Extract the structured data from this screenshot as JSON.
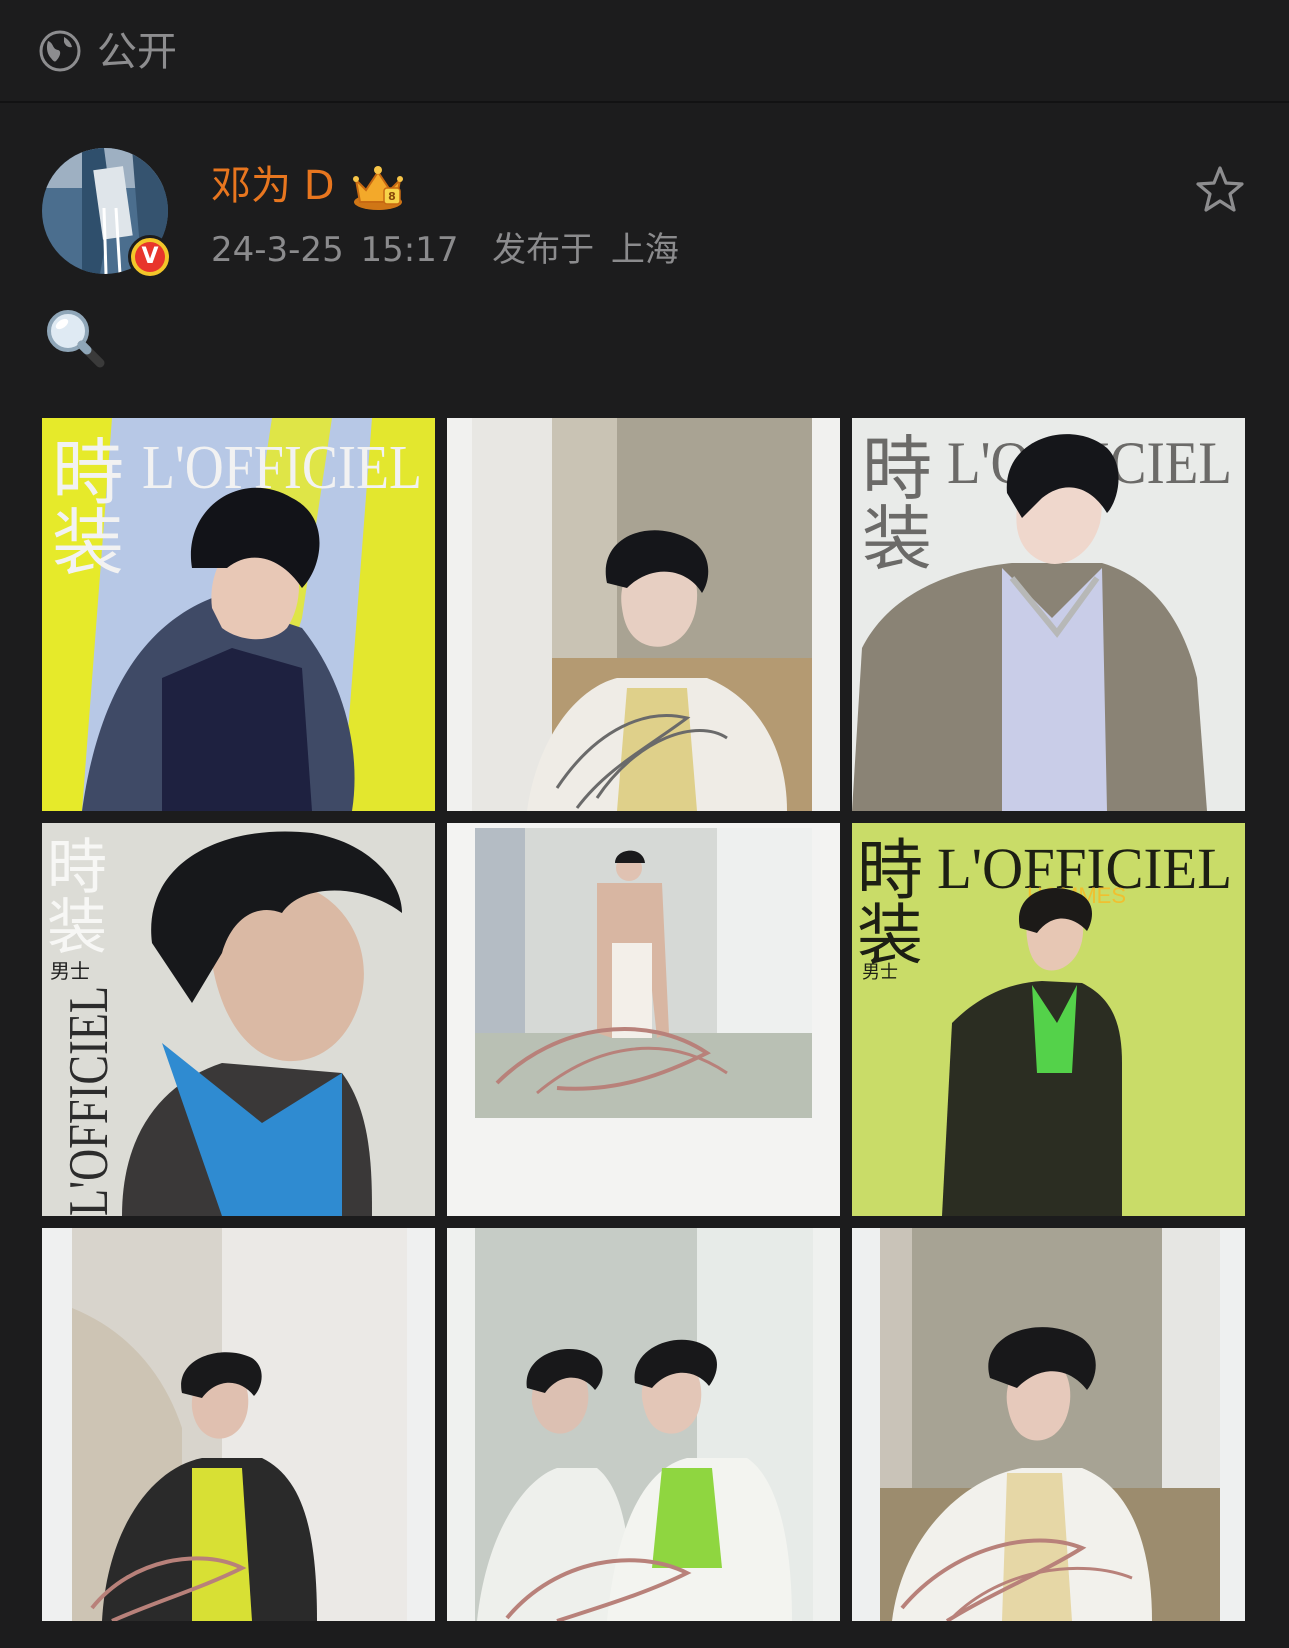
{
  "topbar": {
    "icon": "globe-icon",
    "visibility_label": "公开"
  },
  "post": {
    "author_name": "邓为 D",
    "author_badge": "crown-icon",
    "verified_badge": "V",
    "time": "24-3-25 15:17",
    "location_label": "发布于 上海",
    "content_emoji": "🔍",
    "favorite_icon": "star-icon"
  },
  "photos": [
    {
      "kind": "magazine-cover",
      "masthead": "時装 L'OFFICIEL",
      "bg": "#b7c8e6",
      "accent": "#e6ea2a"
    },
    {
      "kind": "polaroid",
      "bg": "#c9c3b4",
      "accent": "#efece6"
    },
    {
      "kind": "magazine-cover",
      "masthead": "時装 L'OFFICIEL",
      "bg": "#e9ebe9",
      "accent": "#8a8375"
    },
    {
      "kind": "magazine-cover",
      "masthead": "時装 男士 L'OFFICIEL HOMMES",
      "bg": "#dcdcd6",
      "accent": "#2f8bd1"
    },
    {
      "kind": "polaroid",
      "bg": "#d6d9d6",
      "accent": "#d8b6a2"
    },
    {
      "kind": "magazine-cover",
      "masthead": "時装 L'OFFICIEL HOMMES 男士",
      "bg": "#c9dc68",
      "accent": "#2b2d22"
    },
    {
      "kind": "polaroid",
      "bg": "#d8d4cc",
      "accent": "#2a2a2a"
    },
    {
      "kind": "polaroid",
      "bg": "#c6ccc6",
      "accent": "#eef0ec"
    },
    {
      "kind": "polaroid",
      "bg": "#c9c3b8",
      "accent": "#f2f1ec"
    }
  ]
}
